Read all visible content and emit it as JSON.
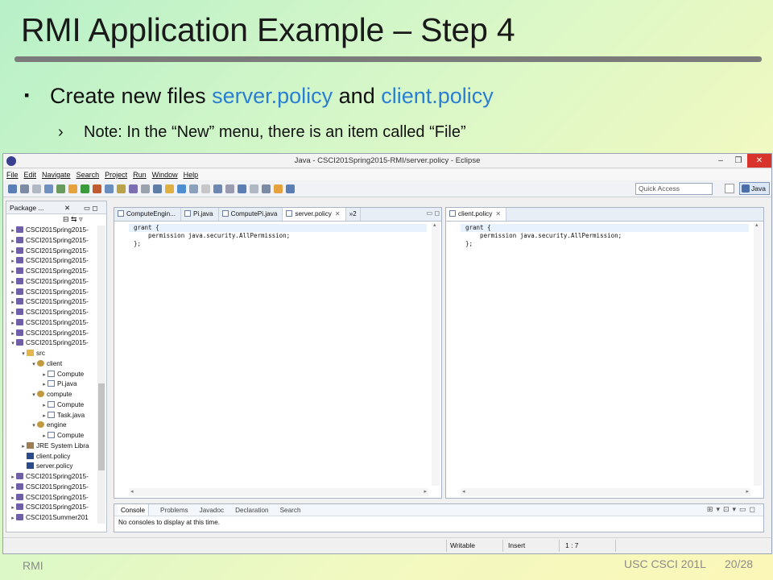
{
  "slide": {
    "title": "RMI Application Example – Step 4",
    "bullet1": {
      "text_a": "Create new files ",
      "file1": "server.policy",
      "text_b": " and ",
      "file2": "client.policy"
    },
    "bullet2": "Note: In the “New” menu, there is an item called “File”",
    "footer_left": "RMI",
    "footer_course": "USC CSCI 201L",
    "footer_page": "20/28",
    "highlight_color": "#2a7fd4"
  },
  "eclipse": {
    "title": "Java - CSCI201Spring2015-RMI/server.policy - Eclipse",
    "menu": [
      "File",
      "Edit",
      "Navigate",
      "Search",
      "Project",
      "Run",
      "Window",
      "Help"
    ],
    "quick_access": "Quick Access",
    "perspective": "Java",
    "package_explorer": {
      "tab_label": "Package ...",
      "rows": [
        {
          "label": "CSCI201Spring2015-",
          "icon": "project",
          "depth": 0,
          "tw": "▸"
        },
        {
          "label": "CSCI201Spring2015-",
          "icon": "project",
          "depth": 0,
          "tw": "▸"
        },
        {
          "label": "CSCI201Spring2015-",
          "icon": "project",
          "depth": 0,
          "tw": "▸"
        },
        {
          "label": "CSCI201Spring2015-",
          "icon": "project",
          "depth": 0,
          "tw": "▸"
        },
        {
          "label": "CSCI201Spring2015-",
          "icon": "project",
          "depth": 0,
          "tw": "▸"
        },
        {
          "label": "CSCI201Spring2015-",
          "icon": "project",
          "depth": 0,
          "tw": "▸"
        },
        {
          "label": "CSCI201Spring2015-",
          "icon": "project",
          "depth": 0,
          "tw": "▸"
        },
        {
          "label": "CSCI201Spring2015-",
          "icon": "project",
          "depth": 0,
          "tw": "▸"
        },
        {
          "label": "CSCI201Spring2015-",
          "icon": "project",
          "depth": 0,
          "tw": "▸"
        },
        {
          "label": "CSCI201Spring2015-",
          "icon": "project",
          "depth": 0,
          "tw": "▸"
        },
        {
          "label": "CSCI201Spring2015-",
          "icon": "project",
          "depth": 0,
          "tw": "▸"
        },
        {
          "label": "CSCI201Spring2015-",
          "icon": "project",
          "depth": 0,
          "tw": "▾"
        },
        {
          "label": "src",
          "icon": "folder",
          "depth": 1,
          "tw": "▾"
        },
        {
          "label": "client",
          "icon": "package",
          "depth": 2,
          "tw": "▾"
        },
        {
          "label": "Compute",
          "icon": "java",
          "depth": 3,
          "tw": "▸"
        },
        {
          "label": "Pi.java",
          "icon": "java",
          "depth": 3,
          "tw": "▸"
        },
        {
          "label": "compute",
          "icon": "package",
          "depth": 2,
          "tw": "▾"
        },
        {
          "label": "Compute",
          "icon": "java",
          "depth": 3,
          "tw": "▸"
        },
        {
          "label": "Task.java",
          "icon": "java",
          "depth": 3,
          "tw": "▸"
        },
        {
          "label": "engine",
          "icon": "package",
          "depth": 2,
          "tw": "▾"
        },
        {
          "label": "Compute",
          "icon": "java",
          "depth": 3,
          "tw": "▸"
        },
        {
          "label": "JRE System Libra",
          "icon": "lib",
          "depth": 1,
          "tw": "▸"
        },
        {
          "label": "client.policy",
          "icon": "file",
          "depth": 1,
          "tw": ""
        },
        {
          "label": "server.policy",
          "icon": "file",
          "depth": 1,
          "tw": ""
        },
        {
          "label": "CSCI201Spring2015-",
          "icon": "project",
          "depth": 0,
          "tw": "▸"
        },
        {
          "label": "CSCI201Spring2015-",
          "icon": "project",
          "depth": 0,
          "tw": "▸"
        },
        {
          "label": "CSCI201Spring2015-",
          "icon": "project",
          "depth": 0,
          "tw": "▸"
        },
        {
          "label": "CSCI201Spring2015-",
          "icon": "project",
          "depth": 0,
          "tw": "▸"
        },
        {
          "label": "CSCI201Summer201",
          "icon": "project",
          "depth": 0,
          "tw": "▸"
        }
      ]
    },
    "left_editor": {
      "tabs": [
        "ComputeEngin...",
        "Pi.java",
        "ComputePi.java",
        "server.policy"
      ],
      "active_tab": "server.policy",
      "overflow": "»2",
      "code": [
        "grant {",
        "    permission java.security.AllPermission;",
        "};"
      ]
    },
    "right_editor": {
      "tabs": [
        "client.policy"
      ],
      "code": [
        "grant {",
        "    permission java.security.AllPermission;",
        "};"
      ]
    },
    "console": {
      "tabs": [
        "Console",
        "Problems",
        "Javadoc",
        "Declaration",
        "Search"
      ],
      "message": "No consoles to display at this time."
    },
    "status": {
      "writable": "Writable",
      "insert": "Insert",
      "position": "1 : 7"
    }
  }
}
